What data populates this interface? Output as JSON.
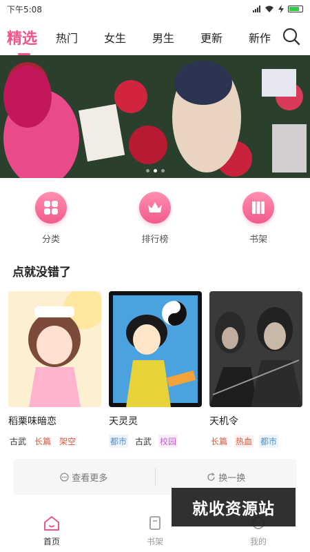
{
  "status": {
    "time": "下午5:08"
  },
  "tabs": [
    {
      "label": "精选"
    },
    {
      "label": "热门"
    },
    {
      "label": "女生"
    },
    {
      "label": "男生"
    },
    {
      "label": "更新"
    },
    {
      "label": "新作"
    }
  ],
  "categories": [
    {
      "label": "分类",
      "icon": "grid-icon"
    },
    {
      "label": "排行榜",
      "icon": "crown-icon"
    },
    {
      "label": "书架",
      "icon": "books-icon"
    }
  ],
  "section": {
    "title": "点就没错了"
  },
  "books": [
    {
      "name": "稻栗味暗恋",
      "tags": [
        "古武",
        "长篇",
        "架空"
      ]
    },
    {
      "name": "天灵灵",
      "tags": [
        "都市",
        "古武",
        "校园"
      ]
    },
    {
      "name": "天机令",
      "tags": [
        "长篇",
        "热血",
        "都市"
      ]
    }
  ],
  "actions": {
    "more": "查看更多",
    "refresh": "换一换"
  },
  "bottomnav": [
    {
      "label": "首页"
    },
    {
      "label": "书架"
    },
    {
      "label": "我的"
    }
  ],
  "watermark": "就收资源站",
  "colors": {
    "accent": "#f0558a",
    "tag_red": "#e0553a",
    "tag_blue": "#4a8fd6",
    "tag_purple": "#c65fd0"
  }
}
